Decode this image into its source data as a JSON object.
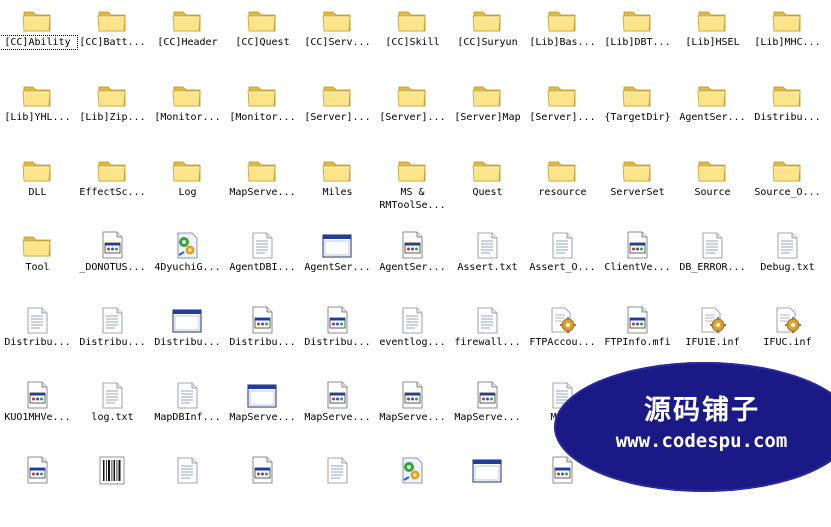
{
  "files": [
    {
      "name": "[CC]Ability",
      "icon": "folder-icon",
      "selected": true
    },
    {
      "name": "[CC]Batt...",
      "icon": "folder-icon"
    },
    {
      "name": "[CC]Header",
      "icon": "folder-icon"
    },
    {
      "name": "[CC]Quest",
      "icon": "folder-icon"
    },
    {
      "name": "[CC]Serv...",
      "icon": "folder-icon"
    },
    {
      "name": "[CC]Skill",
      "icon": "folder-icon"
    },
    {
      "name": "[CC]Suryun",
      "icon": "folder-icon"
    },
    {
      "name": "[Lib]Bas...",
      "icon": "folder-icon"
    },
    {
      "name": "[Lib]DBT...",
      "icon": "folder-icon"
    },
    {
      "name": "[Lib]HSEL",
      "icon": "folder-icon"
    },
    {
      "name": "[Lib]MHC...",
      "icon": "folder-icon"
    },
    {
      "name": "[Lib]YHL...",
      "icon": "folder-icon"
    },
    {
      "name": "[Lib]Zip...",
      "icon": "folder-icon"
    },
    {
      "name": "[Monitor...",
      "icon": "folder-icon"
    },
    {
      "name": "[Monitor...",
      "icon": "folder-icon"
    },
    {
      "name": "[Server]...",
      "icon": "folder-icon"
    },
    {
      "name": "[Server]...",
      "icon": "folder-icon"
    },
    {
      "name": "[Server]Map",
      "icon": "folder-icon"
    },
    {
      "name": "[Server]...",
      "icon": "folder-icon"
    },
    {
      "name": "{TargetDir}",
      "icon": "folder-icon"
    },
    {
      "name": "AgentSer...",
      "icon": "folder-icon"
    },
    {
      "name": "Distribu...",
      "icon": "folder-icon"
    },
    {
      "name": "DLL",
      "icon": "folder-icon"
    },
    {
      "name": "EffectSc...",
      "icon": "folder-icon"
    },
    {
      "name": "Log",
      "icon": "folder-icon"
    },
    {
      "name": "MapServe...",
      "icon": "folder-icon"
    },
    {
      "name": "Miles",
      "icon": "folder-icon"
    },
    {
      "name": "MS &\nRMToolSe...",
      "icon": "folder-icon"
    },
    {
      "name": "Quest",
      "icon": "folder-icon"
    },
    {
      "name": "resource",
      "icon": "folder-icon"
    },
    {
      "name": "ServerSet",
      "icon": "folder-icon"
    },
    {
      "name": "Source",
      "icon": "folder-icon"
    },
    {
      "name": "Source_O...",
      "icon": "folder-icon"
    },
    {
      "name": "Tool",
      "icon": "folder-icon"
    },
    {
      "name": "_DONOTUS...",
      "icon": "visual-studio-file-icon"
    },
    {
      "name": "4DyuchiG...",
      "icon": "workspace-file-icon"
    },
    {
      "name": "AgentDBI...",
      "icon": "text-file-icon"
    },
    {
      "name": "AgentSer...",
      "icon": "application-window-icon"
    },
    {
      "name": "AgentSer...",
      "icon": "visual-studio-file-icon"
    },
    {
      "name": "Assert.txt",
      "icon": "text-file-icon"
    },
    {
      "name": "Assert_O...",
      "icon": "text-file-icon"
    },
    {
      "name": "ClientVe...",
      "icon": "visual-studio-file-icon"
    },
    {
      "name": "DB_ERROR...",
      "icon": "text-file-icon"
    },
    {
      "name": "Debug.txt",
      "icon": "text-file-icon"
    },
    {
      "name": "Distribu...",
      "icon": "text-file-icon"
    },
    {
      "name": "Distribu...",
      "icon": "text-file-icon"
    },
    {
      "name": "Distribu...",
      "icon": "application-window-icon"
    },
    {
      "name": "Distribu...",
      "icon": "visual-studio-file-icon"
    },
    {
      "name": "Distribu...",
      "icon": "visual-studio-file-icon"
    },
    {
      "name": "eventlog...",
      "icon": "text-file-icon"
    },
    {
      "name": "firewall...",
      "icon": "text-file-icon"
    },
    {
      "name": "FTPAccou...",
      "icon": "config-file-icon"
    },
    {
      "name": "FTPInfo.mfi",
      "icon": "visual-studio-file-icon"
    },
    {
      "name": "IFU1E.inf",
      "icon": "config-file-icon"
    },
    {
      "name": "IFUC.inf",
      "icon": "config-file-icon"
    },
    {
      "name": "KUO1MHVe...",
      "icon": "visual-studio-file-icon"
    },
    {
      "name": "log.txt",
      "icon": "text-file-icon"
    },
    {
      "name": "MapDBInf...",
      "icon": "text-file-icon"
    },
    {
      "name": "MapServe...",
      "icon": "application-window-icon"
    },
    {
      "name": "MapServe...",
      "icon": "visual-studio-file-icon"
    },
    {
      "name": "MapServe...",
      "icon": "visual-studio-file-icon"
    },
    {
      "name": "MapServe...",
      "icon": "visual-studio-file-icon"
    },
    {
      "name": "MapS",
      "icon": "text-file-icon"
    },
    {
      "name": "",
      "icon": "none"
    },
    {
      "name": "",
      "icon": "none"
    },
    {
      "name": "",
      "icon": "none"
    },
    {
      "name": "",
      "icon": "visual-studio-file-icon"
    },
    {
      "name": "",
      "icon": "barcode-file-icon"
    },
    {
      "name": "",
      "icon": "text-file-icon"
    },
    {
      "name": "",
      "icon": "visual-studio-file-icon"
    },
    {
      "name": "",
      "icon": "text-file-icon"
    },
    {
      "name": "",
      "icon": "workspace-file-icon"
    },
    {
      "name": "",
      "icon": "application-window-icon"
    },
    {
      "name": "",
      "icon": "visual-studio-file-icon"
    }
  ],
  "watermark": {
    "title": "源码铺子",
    "url": "www.codespu.com"
  },
  "colors": {
    "folder": "#f8df7c",
    "folder_dark": "#d9b33c",
    "watermark_bg": "#1a1985",
    "window_title": "#1f3f9b"
  }
}
